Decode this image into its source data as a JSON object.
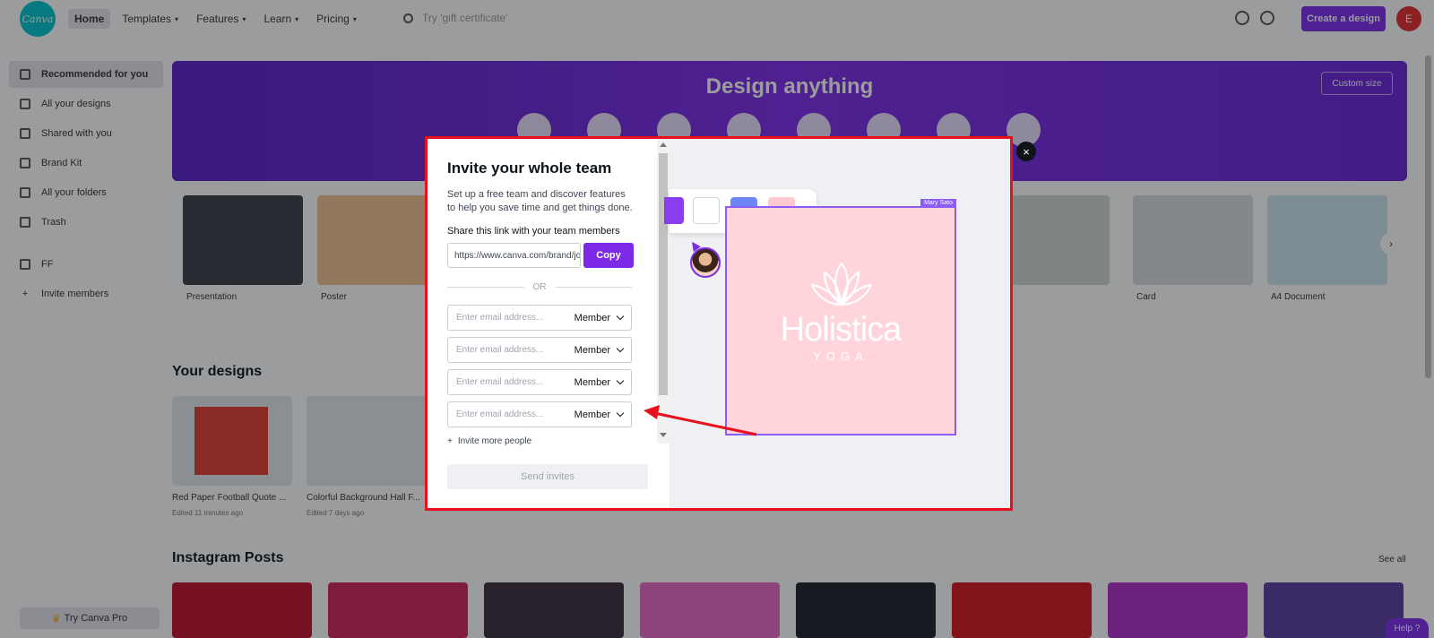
{
  "app": {
    "logo_text": "Canva",
    "nav": [
      {
        "label": "Home"
      },
      {
        "label": "Templates"
      },
      {
        "label": "Features"
      },
      {
        "label": "Learn"
      },
      {
        "label": "Pricing"
      }
    ],
    "search_placeholder": "Try 'gift certificate'",
    "create_button": "Create a design",
    "avatar_initial": "E"
  },
  "sidebar": {
    "items": [
      {
        "label": "Recommended for you"
      },
      {
        "label": "All your designs"
      },
      {
        "label": "Shared with you"
      },
      {
        "label": "Brand Kit"
      },
      {
        "label": "All your folders"
      },
      {
        "label": "Trash"
      }
    ],
    "team_items": [
      {
        "label": "FF"
      },
      {
        "label": "Invite members"
      }
    ],
    "try_pro": "Try Canva Pro"
  },
  "hero": {
    "title": "Design anything",
    "button": "Custom size"
  },
  "templates": {
    "labels": [
      "Presentation",
      "Poster",
      "",
      "",
      "",
      "",
      "Card",
      "A4 Document"
    ]
  },
  "designs": {
    "title": "Your designs",
    "cards": [
      {
        "label": "Red Paper Football Quote ...",
        "sub": "Edited 11 minutes ago"
      },
      {
        "label": "Colorful Background Hall F...",
        "sub": "Edited 7 days ago"
      }
    ]
  },
  "instagram": {
    "title": "Instagram Posts",
    "see_all": "See all"
  },
  "help_label": "Help ?",
  "modal": {
    "title": "Invite your whole team",
    "description": "Set up a free team and discover features to help you save time and get things done.",
    "share_label": "Share this link with your team members",
    "link_value": "https://www.canva.com/brand/join?token=",
    "copy_button": "Copy",
    "or_label": "OR",
    "email_placeholder": "Enter email address...",
    "role_label": "Member",
    "invite_more": "Invite more people",
    "send_button": "Send invites",
    "close_symbol": "×",
    "canvas": {
      "owner_tag": "Mary Sato",
      "brand_name": "Holistica",
      "brand_sub": "YOGA",
      "swatches": [
        "#8b3cf0",
        "#ffffff",
        "#6e86f5",
        "#ffc9cf"
      ]
    }
  },
  "colors": {
    "accent": "#7d2ae8",
    "highlight_border": "#e8101a"
  }
}
